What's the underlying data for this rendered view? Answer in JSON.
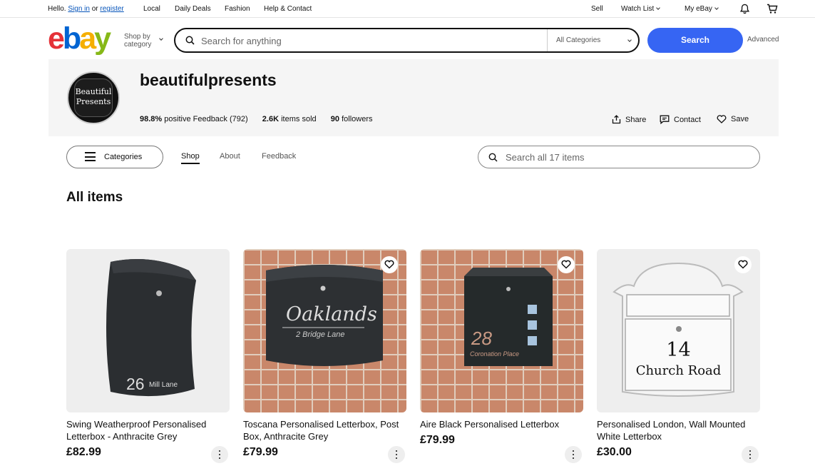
{
  "topbar": {
    "hello": "Hello.",
    "sign_in": "Sign in",
    "or": "or",
    "register": "register",
    "local": "Local",
    "daily_deals": "Daily Deals",
    "fashion": "Fashion",
    "help_contact": "Help & Contact",
    "sell": "Sell",
    "watch_list": "Watch List",
    "my_ebay": "My eBay"
  },
  "header": {
    "logo_letters": [
      "e",
      "b",
      "a",
      "y"
    ],
    "shop_by_line1": "Shop by",
    "shop_by_line2": "category",
    "search_placeholder": "Search for anything",
    "category_select": "All Categories",
    "search_button": "Search",
    "advanced": "Advanced"
  },
  "store": {
    "logo_line1": "Beautiful",
    "logo_line2": "Presents",
    "name": "beautifulpresents",
    "feedback_pct": "98.8%",
    "feedback_text": "positive Feedback (792)",
    "items_sold_num": "2.6K",
    "items_sold_text": "items sold",
    "followers_num": "90",
    "followers_text": "followers",
    "share": "Share",
    "contact": "Contact",
    "save": "Save"
  },
  "store_nav": {
    "categories": "Categories",
    "tabs": [
      "Shop",
      "About",
      "Feedback"
    ],
    "active_tab": "Shop",
    "search_placeholder": "Search all 17 items"
  },
  "section_title": "All items",
  "products": [
    {
      "title": "Swing Weatherproof Personalised Letterbox - Anthracite Grey",
      "price": "£82.99",
      "img_text": "26",
      "img_subtext": "Mill Lane"
    },
    {
      "title": "Toscana Personalised Letterbox, Post Box, Anthracite Grey",
      "price": "£79.99",
      "img_text": "Oaklands",
      "img_subtext": "2 Bridge Lane"
    },
    {
      "title": "Aire Black Personalised Letterbox",
      "price": "£79.99",
      "img_text": "28",
      "img_subtext": "Coronation Place"
    },
    {
      "title": "Personalised London, Wall Mounted White Letterbox",
      "price": "£30.00",
      "img_text": "14",
      "img_subtext": "Church Road"
    }
  ],
  "colors": {
    "accent": "#3665f3",
    "link": "#0654ba",
    "banner_bg": "#f5f5f5"
  }
}
